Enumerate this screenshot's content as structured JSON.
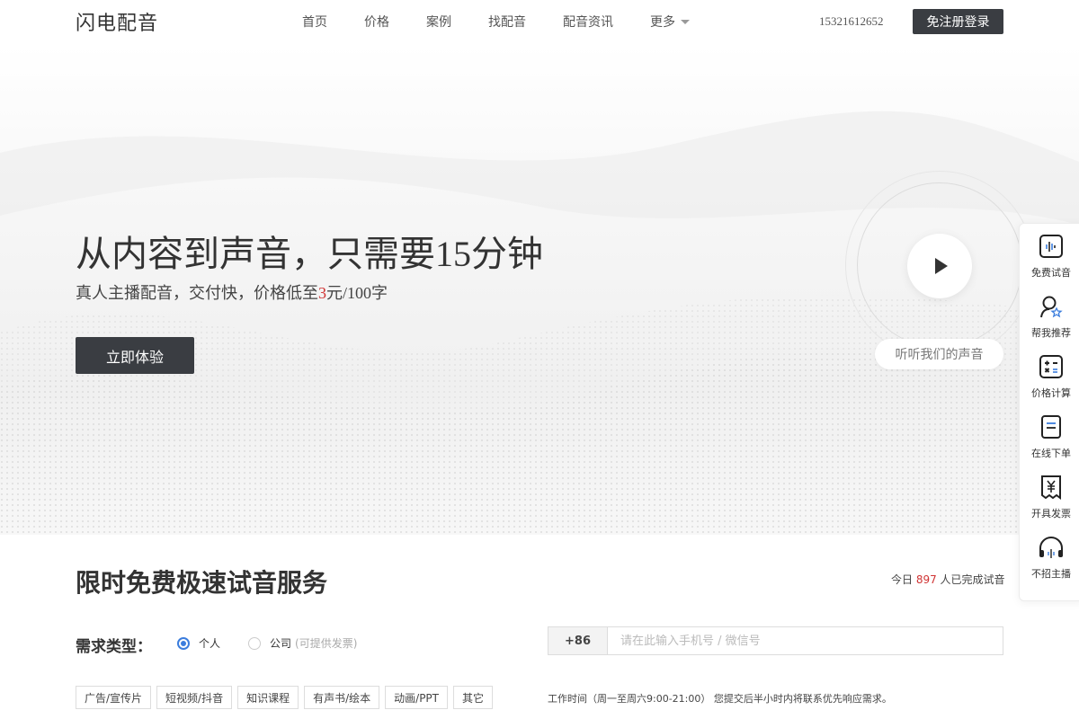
{
  "header": {
    "logo_text": "闪电配音",
    "nav": [
      {
        "label": "首页"
      },
      {
        "label": "价格"
      },
      {
        "label": "案例"
      },
      {
        "label": "找配音"
      },
      {
        "label": "配音资讯"
      },
      {
        "label": "更多"
      }
    ],
    "phone": "15321612652",
    "login_label": "免注册登录"
  },
  "hero": {
    "title": "从内容到声音，只需要15分钟",
    "subtitle_before": "真人主播配音，交付快，价格低至",
    "subtitle_price": "3",
    "subtitle_after": "元/100字",
    "cta_label": "立即体验",
    "listen_label": "听听我们的声音"
  },
  "sidebar": {
    "items": [
      {
        "label": "免费试音",
        "icon": "audio-wave-icon"
      },
      {
        "label": "帮我推荐",
        "icon": "user-star-icon"
      },
      {
        "label": "价格计算",
        "icon": "calculator-icon"
      },
      {
        "label": "在线下单",
        "icon": "document-icon"
      },
      {
        "label": "开具发票",
        "icon": "invoice-yen-icon"
      },
      {
        "label": "不招主播",
        "icon": "headphones-icon"
      }
    ]
  },
  "trial": {
    "title": "限时免费极速试音服务",
    "today_before": "今日 ",
    "today_count": "897",
    "today_after": " 人已完成试音",
    "demand_label": "需求类型：",
    "radio_personal": "个人",
    "radio_company": "公司",
    "radio_company_hint": "(可提供发票)",
    "selected": "personal",
    "country_code": "+86",
    "phone_placeholder": "请在此输入手机号 / 微信号",
    "tags": [
      "广告/宣传片",
      "短视频/抖音",
      "知识课程",
      "有声书/绘本",
      "动画/PPT",
      "其它"
    ],
    "work_time": "工作时间（周一至周六9:00-21:00） 您提交后半小时内将联系优先响应需求。"
  },
  "colors": {
    "accent_dark": "#3a3d42",
    "price_red": "#d03333",
    "radio_blue": "#3b7ddd"
  }
}
